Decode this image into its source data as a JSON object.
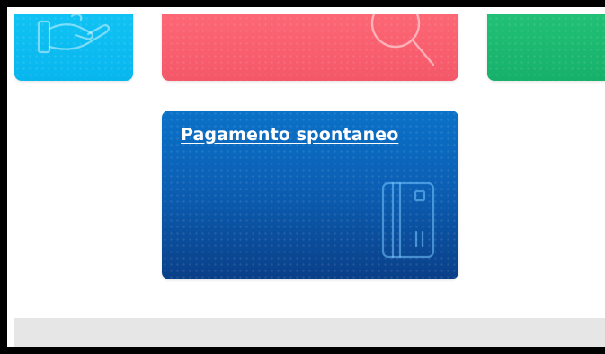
{
  "services": {
    "payment_card": {
      "title": "Pagamento spontaneo",
      "icon": "credit-card-icon",
      "color": "#0b5fb4"
    },
    "support_card": {
      "icon": "hand-support-icon",
      "color": "#08b6ee"
    },
    "search_card": {
      "icon": "search-icon",
      "color": "#f45868"
    },
    "green_card": {
      "color": "#16b06a"
    }
  },
  "footer": {
    "color": "#e6e6e6"
  }
}
